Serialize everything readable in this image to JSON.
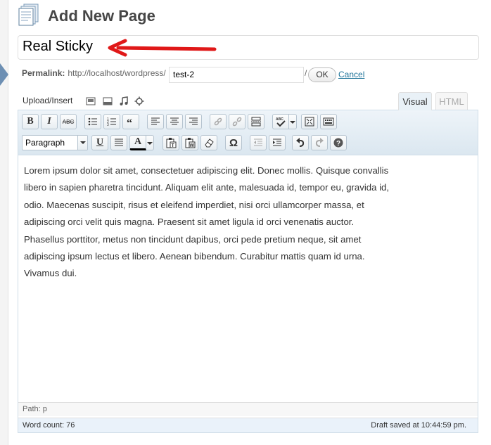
{
  "header": {
    "title": "Add New Page",
    "icon": "page-icon"
  },
  "post_title": {
    "value": "Real Sticky",
    "annotation_color": "#e01818"
  },
  "permalink": {
    "label": "Permalink:",
    "base_url": "http://localhost/wordpress/",
    "slug": "test-2",
    "slash": "/",
    "ok_label": "OK",
    "cancel_label": "Cancel"
  },
  "media": {
    "label": "Upload/Insert",
    "icons": [
      "image-icon",
      "video-icon",
      "audio-icon",
      "media-icon"
    ]
  },
  "tabs": [
    {
      "label": "Visual",
      "active": true
    },
    {
      "label": "HTML",
      "active": false
    }
  ],
  "toolbar": {
    "row1": [
      "bold",
      "italic",
      "strikethrough",
      "bullet-list",
      "numbered-list",
      "blockquote",
      "align-left",
      "align-center",
      "align-right",
      "link",
      "unlink",
      "more",
      "spellcheck",
      "fullscreen",
      "kitchen-sink"
    ],
    "row2": [
      "paragraph-format",
      "underline",
      "justify",
      "text-color",
      "paste-text",
      "paste-word",
      "clear-formatting",
      "special-character",
      "outdent",
      "indent",
      "undo",
      "redo",
      "help"
    ],
    "bold_label": "B",
    "italic_label": "I",
    "strike_label": "ABC",
    "underline_label": "U",
    "color_label": "A",
    "omega_label": "Ω",
    "format_value": "Paragraph"
  },
  "content": {
    "lines": [
      "Lorem ipsum dolor sit amet, consectetuer adipiscing elit. Donec mollis. Quisque convallis",
      "libero in sapien pharetra tincidunt. Aliquam elit ante, malesuada id, tempor eu, gravida id,",
      "odio. Maecenas suscipit, risus et eleifend imperdiet, nisi orci ullamcorper massa, et",
      "adipiscing orci velit quis magna. Praesent sit amet ligula id orci venenatis auctor.",
      "Phasellus porttitor, metus non tincidunt dapibus, orci pede pretium neque, sit amet",
      "adipiscing ipsum lectus et libero. Aenean bibendum. Curabitur mattis quam id urna.",
      "Vivamus dui."
    ]
  },
  "path": "Path: p",
  "status": {
    "word_count": "Word count: 76",
    "draft_saved": "Draft saved at 10:44:59 pm."
  },
  "colors": {
    "link": "#21759b",
    "toolbar_bg": "#dbe7f0",
    "status_bg": "#eaf2fa"
  }
}
